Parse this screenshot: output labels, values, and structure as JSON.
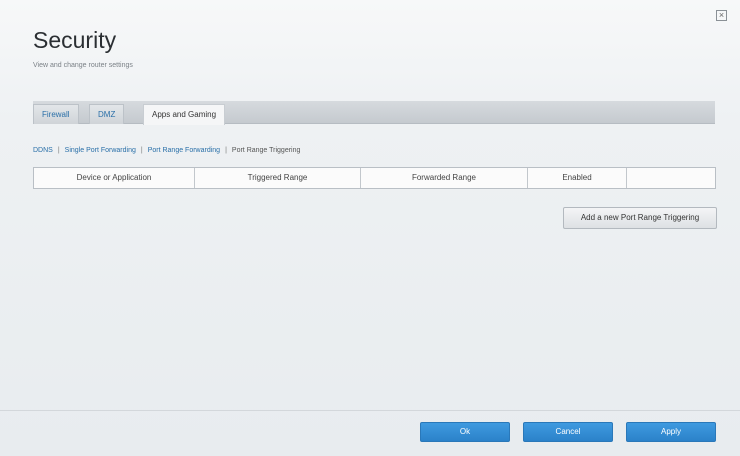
{
  "header": {
    "title": "Security",
    "subtitle": "View and change router settings"
  },
  "window": {
    "close_icon": "×"
  },
  "tabs": [
    {
      "label": "Firewall",
      "active": false
    },
    {
      "label": "DMZ",
      "active": false
    },
    {
      "label": "Apps and Gaming",
      "active": true
    }
  ],
  "subnav": {
    "items": [
      "DDNS",
      "Single Port Forwarding",
      "Port Range Forwarding",
      "Port Range Triggering"
    ],
    "current": "Port Range Triggering",
    "separator": "|"
  },
  "table": {
    "columns": [
      "Device or Application",
      "Triggered Range",
      "Forwarded Range",
      "Enabled",
      ""
    ]
  },
  "actions": {
    "add_label": "Add a new Port Range Triggering"
  },
  "footer": {
    "ok_label": "Ok",
    "cancel_label": "Cancel",
    "apply_label": "Apply"
  },
  "colors": {
    "accent": "#2b82c9",
    "link": "#2a6fa8"
  }
}
